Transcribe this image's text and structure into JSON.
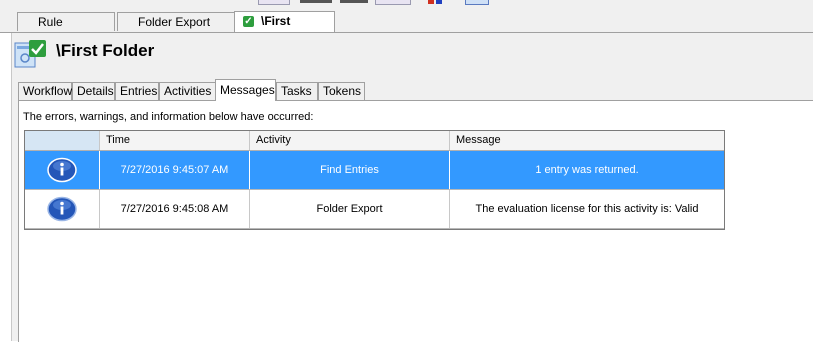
{
  "colors": {
    "selection": "#3399ff",
    "check_green": "#2e9e3e",
    "info_blue": "#2456b8"
  },
  "doc_tabs": [
    {
      "label": "Rule Manager"
    },
    {
      "label": "Folder Export Test"
    },
    {
      "label": "\\First Folder",
      "active": true,
      "icon": "check-icon"
    }
  ],
  "header": {
    "title": "\\First Folder",
    "icon": "folder-rule-icon"
  },
  "tabs": [
    {
      "label": "Workflow"
    },
    {
      "label": "Details"
    },
    {
      "label": "Entries"
    },
    {
      "label": "Activities"
    },
    {
      "label": "Messages",
      "active": true
    },
    {
      "label": "Tasks"
    },
    {
      "label": "Tokens"
    }
  ],
  "messages": {
    "intro": "The errors, warnings, and information below have occurred:",
    "columns": [
      "",
      "Time",
      "Activity",
      "Message"
    ],
    "rows": [
      {
        "icon": "info-icon",
        "time": "7/27/2016 9:45:07 AM",
        "activity": "Find Entries",
        "message": "1 entry was returned.",
        "selected": true
      },
      {
        "icon": "info-icon",
        "time": "7/27/2016 9:45:08 AM",
        "activity": "Folder Export",
        "message": "The evaluation license for this activity is: Valid",
        "selected": false
      }
    ]
  }
}
